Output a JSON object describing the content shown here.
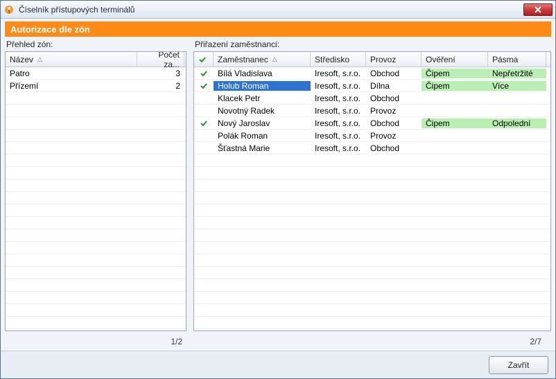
{
  "window": {
    "title": "Číselník přístupových terminálů",
    "close_icon": "close"
  },
  "subheader": "Autorizace dle zón",
  "left": {
    "caption": "Přehled zón:",
    "columns": {
      "name": "Název",
      "count": "Počet za..."
    },
    "rows": [
      {
        "name": "Patro",
        "count": "3"
      },
      {
        "name": "Přízemí",
        "count": "2"
      }
    ],
    "pager": "1/2"
  },
  "right": {
    "caption": "Přiřazení zaměstnanci:",
    "columns": {
      "chk": "",
      "name": "Zaměstnanec",
      "center": "Středisko",
      "op": "Provoz",
      "auth": "Ověření",
      "band": "Pásma"
    },
    "rows": [
      {
        "chk": true,
        "name": "Bílá Vladislava",
        "center": "Iresoft, s.r.o.",
        "op": "Obchod",
        "auth": "Čipem",
        "band": "Nepřetržité",
        "hl": true,
        "sel": false
      },
      {
        "chk": true,
        "name": "Holub Roman",
        "center": "Iresoft, s.r.o.",
        "op": "Dílna",
        "auth": "Čipem",
        "band": "Více",
        "hl": true,
        "sel": true
      },
      {
        "chk": false,
        "name": "Klacek Petr",
        "center": "Iresoft, s.r.o.",
        "op": "Obchod",
        "auth": "",
        "band": "",
        "hl": false,
        "sel": false
      },
      {
        "chk": false,
        "name": "Novotný Radek",
        "center": "Iresoft, s.r.o.",
        "op": "Provoz",
        "auth": "",
        "band": "",
        "hl": false,
        "sel": false
      },
      {
        "chk": true,
        "name": "Nový Jaroslav",
        "center": "Iresoft, s.r.o.",
        "op": "Obchod",
        "auth": "Čipem",
        "band": "Odpolední",
        "hl": true,
        "sel": false
      },
      {
        "chk": false,
        "name": "Polák Roman",
        "center": "Iresoft, s.r.o.",
        "op": "Provoz",
        "auth": "",
        "band": "",
        "hl": false,
        "sel": false
      },
      {
        "chk": false,
        "name": "Šťastná Marie",
        "center": "Iresoft, s.r.o.",
        "op": "Obchod",
        "auth": "",
        "band": "",
        "hl": false,
        "sel": false
      }
    ],
    "pager": "2/7"
  },
  "buttons": {
    "close": "Zavřít"
  }
}
